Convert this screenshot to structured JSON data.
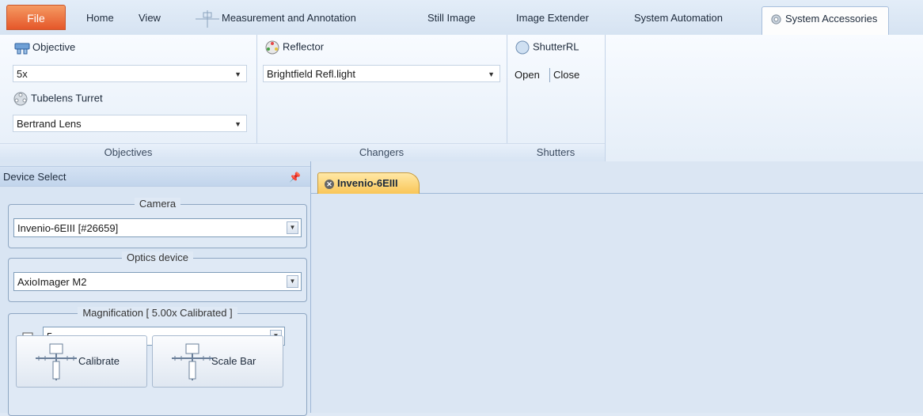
{
  "tabs": {
    "file": "File",
    "home": "Home",
    "view": "View",
    "measurement": "Measurement and Annotation",
    "still_image": "Still Image",
    "image_extender": "Image Extender",
    "system_automation": "System Automation",
    "system_accessories": "System Accessories"
  },
  "ribbon": {
    "objectives": {
      "objective_label": "Objective",
      "objective_value": "5x",
      "tubelens_label": "Tubelens Turret",
      "tubelens_value": "Bertrand Lens",
      "group_label": "Objectives"
    },
    "changers": {
      "reflector_label": "Reflector",
      "reflector_value": "Brightfield Refl.light",
      "group_label": "Changers"
    },
    "shutters": {
      "shutter_label": "ShutterRL",
      "open": "Open",
      "close": "Close",
      "group_label": "Shutters"
    }
  },
  "panel": {
    "title": "Device Select",
    "camera": {
      "legend": "Camera",
      "value": "Invenio-6EIII  [#26659]"
    },
    "optics": {
      "legend": "Optics device",
      "value": "AxioImager M2"
    },
    "magnification": {
      "legend": "Magnification [ 5.00x Calibrated ]",
      "value": "5",
      "calibrate": "Calibrate",
      "scale_bar": "Scale Bar"
    }
  },
  "document": {
    "tab_label": "Invenio-6EIII"
  },
  "colors": {
    "file_tab": "#e5572a",
    "doc_tab": "#f9c657",
    "accent": "#a8bfdc"
  }
}
